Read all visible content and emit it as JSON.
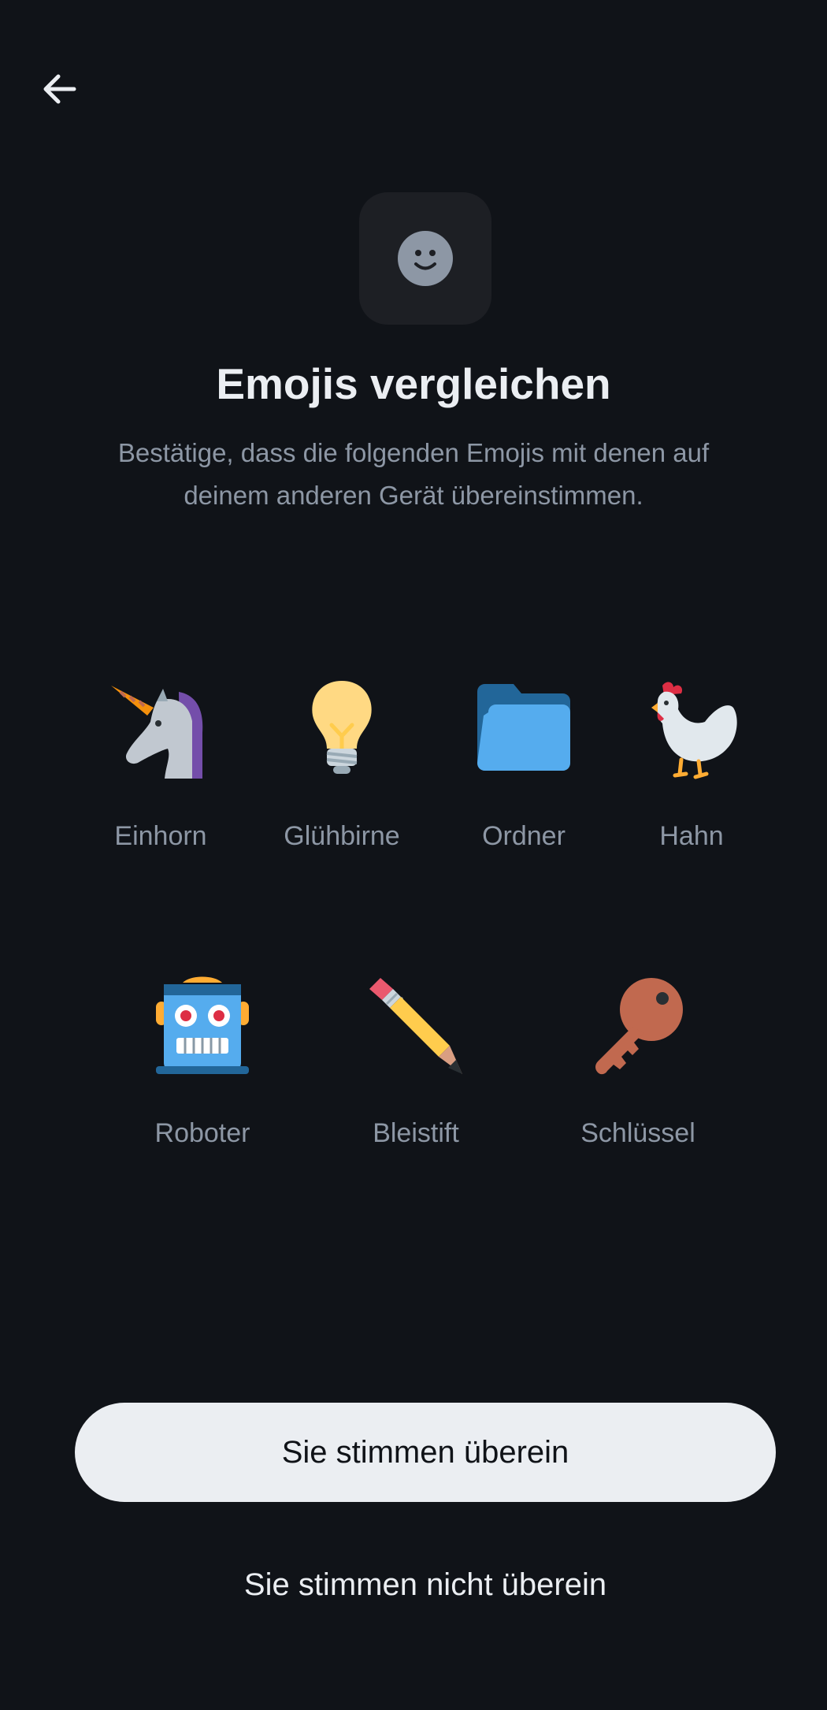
{
  "header": {
    "back_icon": "arrow-left-icon",
    "badge_icon": "smiley-face-icon"
  },
  "title": "Emojis vergleichen",
  "subtitle": "Bestätige, dass die folgenden Emojis mit denen auf deinem anderen Gerät übereinstimmen.",
  "emojis": [
    {
      "icon": "unicorn-icon",
      "label": "Einhorn"
    },
    {
      "icon": "lightbulb-icon",
      "label": "Glühbirne"
    },
    {
      "icon": "folder-icon",
      "label": "Ordner"
    },
    {
      "icon": "rooster-icon",
      "label": "Hahn"
    },
    {
      "icon": "robot-icon",
      "label": "Roboter"
    },
    {
      "icon": "pencil-icon",
      "label": "Bleistift"
    },
    {
      "icon": "key-icon",
      "label": "Schlüssel"
    }
  ],
  "actions": {
    "match_label": "Sie stimmen überein",
    "no_match_label": "Sie stimmen nicht überein"
  },
  "colors": {
    "background": "#101318",
    "text_primary": "#ebeef2",
    "text_secondary": "#8d97a5",
    "badge_background": "#1d1f24"
  }
}
